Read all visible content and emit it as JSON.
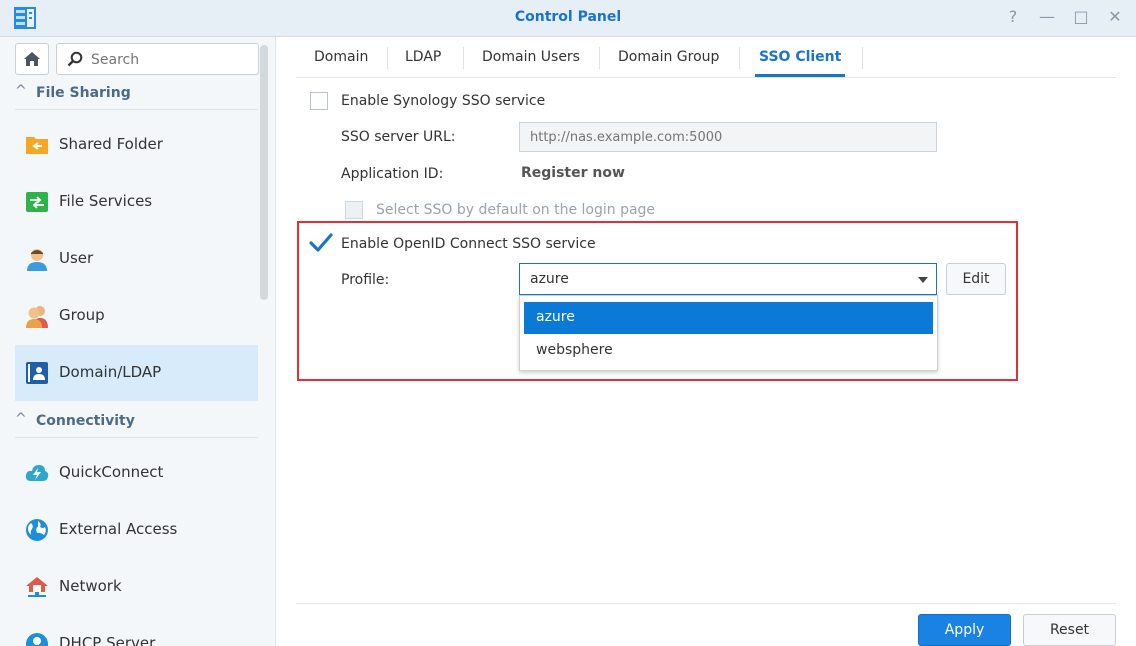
{
  "window": {
    "title": "Control Panel",
    "logo_icon": "control-panel-logo-icon",
    "buttons": [
      "help-icon",
      "minimize-icon",
      "maximize-icon",
      "close-icon"
    ],
    "help_glyph": "?",
    "minimize_glyph": "—",
    "maximize_glyph": "□",
    "close_glyph": "✕"
  },
  "sidebar": {
    "search_placeholder": "Search",
    "sections": [
      {
        "label": "File Sharing",
        "chevron": "^"
      },
      {
        "label": "Connectivity",
        "chevron": "^"
      }
    ],
    "items": [
      {
        "label": "Shared Folder",
        "icon": "shared-folder-icon",
        "color": "#f5a623"
      },
      {
        "label": "File Services",
        "icon": "file-services-icon",
        "color": "#2eb24a"
      },
      {
        "label": "User",
        "icon": "user-icon",
        "color": "#e8a34a"
      },
      {
        "label": "Group",
        "icon": "group-icon",
        "color": "#e8a34a"
      },
      {
        "label": "Domain/LDAP",
        "icon": "domain-ldap-icon",
        "color": "#1f5fa8",
        "active": true
      },
      {
        "label": "QuickConnect",
        "icon": "quickconnect-icon",
        "color": "#2ea8c9"
      },
      {
        "label": "External Access",
        "icon": "external-access-icon",
        "color": "#1d8fd8"
      },
      {
        "label": "Network",
        "icon": "network-icon",
        "color": "#e05a4a"
      },
      {
        "label": "DHCP Server",
        "icon": "dhcp-server-icon",
        "color": "#1d8fd8"
      }
    ]
  },
  "tabs": [
    {
      "label": "Domain"
    },
    {
      "label": "LDAP"
    },
    {
      "label": "Domain Users"
    },
    {
      "label": "Domain Group"
    },
    {
      "label": "SSO Client",
      "active": true
    }
  ],
  "sso": {
    "enable_synology_label": "Enable Synology SSO service",
    "enable_synology_checked": false,
    "server_url_label": "SSO server URL:",
    "server_url_placeholder": "http://nas.example.com:5000",
    "app_id_label": "Application ID:",
    "register_now": "Register now",
    "select_default_label": "Select SSO by default on the login page",
    "enable_openid_label": "Enable OpenID Connect SSO service",
    "enable_openid_checked": true,
    "profile_label": "Profile:",
    "profile_value": "azure",
    "profile_options": [
      "azure",
      "websphere"
    ],
    "edit_label": "Edit"
  },
  "footer": {
    "apply_label": "Apply",
    "reset_label": "Reset"
  },
  "colors": {
    "accent": "#1a75c9",
    "highlight_frame": "#e0313a",
    "selected_option": "#0b7ad6"
  }
}
